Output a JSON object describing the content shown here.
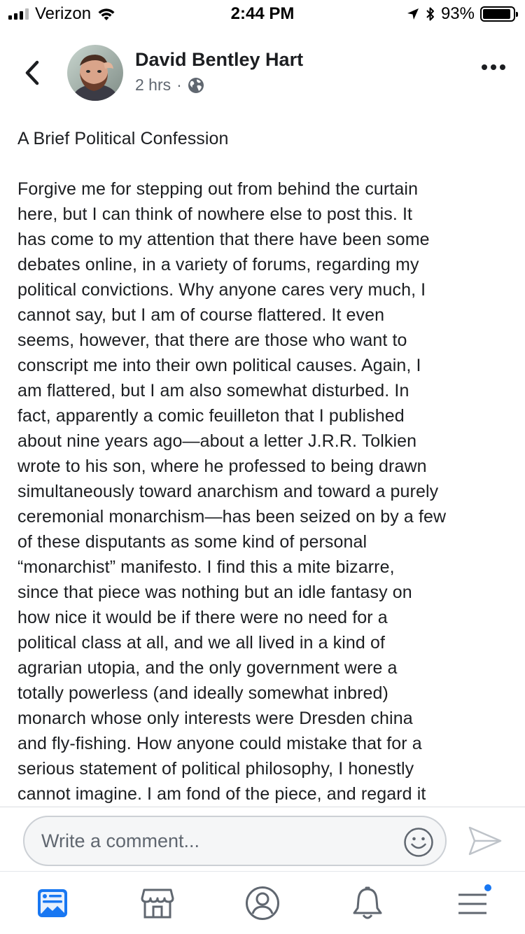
{
  "status_bar": {
    "carrier": "Verizon",
    "time": "2:44 PM",
    "battery_percent": "93%",
    "battery_level": 0.93,
    "signal_bars_active": 3,
    "signal_bars_total": 4
  },
  "header": {
    "author_name": "David Bentley Hart",
    "timestamp": "2 hrs",
    "separator": "·",
    "privacy_icon": "globe-icon"
  },
  "post": {
    "title": "A Brief Political Confession",
    "lines": [
      "Forgive me for stepping out from behind the curtain",
      "here, but I can think of nowhere else to post this.  It",
      "has come to my attention that there have been some",
      "debates online, in a variety of forums, regarding my",
      "political convictions.  Why anyone cares very much, I",
      "cannot say, but I am of course flattered.  It even",
      "seems, however, that there are those who want to",
      "conscript me into their own political causes.  Again, I",
      "am flattered, but I am also somewhat disturbed.  In",
      "fact, apparently a comic feuilleton that I published",
      "about nine years ago—about a letter J.R.R. Tolkien",
      "wrote to his son, where he professed to being drawn",
      "simultaneously toward anarchism and toward a purely",
      "ceremonial monarchism—has been seized on by a few",
      "of these disputants as some kind of personal",
      "“monarchist” manifesto.  I find this a mite bizarre,",
      "since that piece was nothing but an idle fantasy on",
      "how nice it would be if there were no need for a",
      "political class at all, and we all lived in a kind of",
      "agrarian utopia, and the only government were a",
      "totally powerless (and ideally somewhat inbred)",
      "monarch whose only interests were Dresden china",
      "and fly-fishing.  How anyone could mistake that for a",
      "serious statement of political philosophy, I honestly",
      "cannot imagine.  I am fond of the piece, and regard it"
    ]
  },
  "comment_bar": {
    "placeholder": "Write a comment...",
    "emoji_icon": "smiley-icon",
    "send_icon": "send-icon"
  },
  "tab_bar": {
    "tabs": [
      {
        "name": "news-feed",
        "icon": "news-feed-icon",
        "active": true
      },
      {
        "name": "marketplace",
        "icon": "marketplace-icon",
        "active": false
      },
      {
        "name": "profile",
        "icon": "profile-icon",
        "active": false
      },
      {
        "name": "notifications",
        "icon": "bell-icon",
        "active": false
      },
      {
        "name": "menu",
        "icon": "menu-icon",
        "active": false,
        "badge": true
      }
    ]
  },
  "colors": {
    "accent": "#1877f2",
    "text": "#1c1e21",
    "secondary_text": "#606770",
    "icon_gray": "#606770"
  }
}
